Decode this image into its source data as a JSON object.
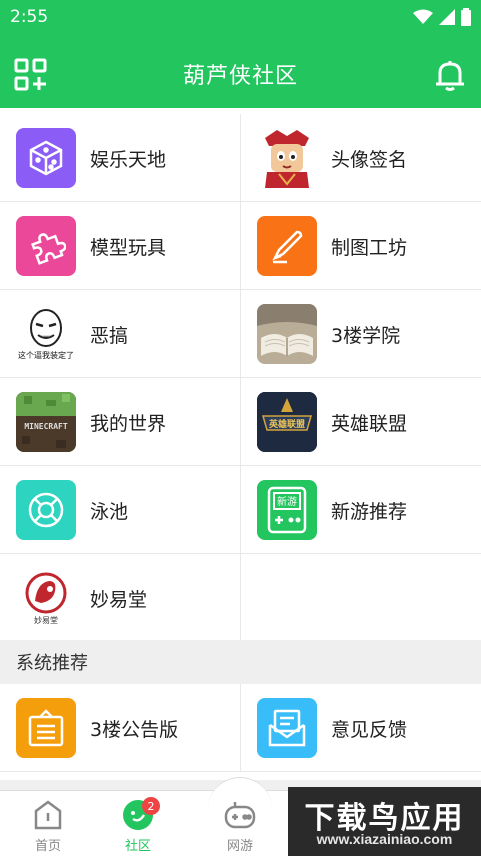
{
  "status_bar": {
    "time": "2:55"
  },
  "app_bar": {
    "title": "葫芦侠社区"
  },
  "boards": [
    {
      "label": "娱乐天地",
      "icon": "dice-icon",
      "color": "#8b5cf6"
    },
    {
      "label": "头像签名",
      "icon": "cartoon-avatar-icon",
      "color": "#ffffff"
    },
    {
      "label": "模型玩具",
      "icon": "puzzle-icon",
      "color": "#ec4899"
    },
    {
      "label": "制图工坊",
      "icon": "pen-icon",
      "color": "#f97316"
    },
    {
      "label": "恶搞",
      "icon": "meme-face-icon",
      "color": "#ffffff",
      "icon_text": "这个逼我装定了"
    },
    {
      "label": "3楼学院",
      "icon": "book-icon",
      "color": "#d6cfc2"
    },
    {
      "label": "我的世界",
      "icon": "minecraft-icon",
      "color": "#5a8a3a",
      "icon_text": "MINECRAFT"
    },
    {
      "label": "英雄联盟",
      "icon": "lol-icon",
      "color": "#1f2a44",
      "icon_text": "英雄联盟"
    },
    {
      "label": "泳池",
      "icon": "lifebuoy-icon",
      "color": "#2dd4bf"
    },
    {
      "label": "新游推荐",
      "icon": "gamepad-new-icon",
      "color": "#22c55e",
      "icon_text": "新游"
    },
    {
      "label": "妙易堂",
      "icon": "miaoyitang-icon",
      "color": "#ffffff",
      "icon_text": "妙易堂"
    }
  ],
  "system_section": {
    "title": "系统推荐",
    "items": [
      {
        "label": "3楼公告版",
        "icon": "notice-board-icon",
        "color": "#f59e0b"
      },
      {
        "label": "意见反馈",
        "icon": "feedback-mail-icon",
        "color": "#38bdf8"
      }
    ]
  },
  "tabs": [
    {
      "label": "首页",
      "icon": "home-icon"
    },
    {
      "label": "社区",
      "icon": "community-icon",
      "badge": "2"
    },
    {
      "label": "网游",
      "icon": "gamepad-icon"
    }
  ],
  "watermark": {
    "title": "下载鸟应用",
    "url": "www.xiazainiao.com"
  }
}
